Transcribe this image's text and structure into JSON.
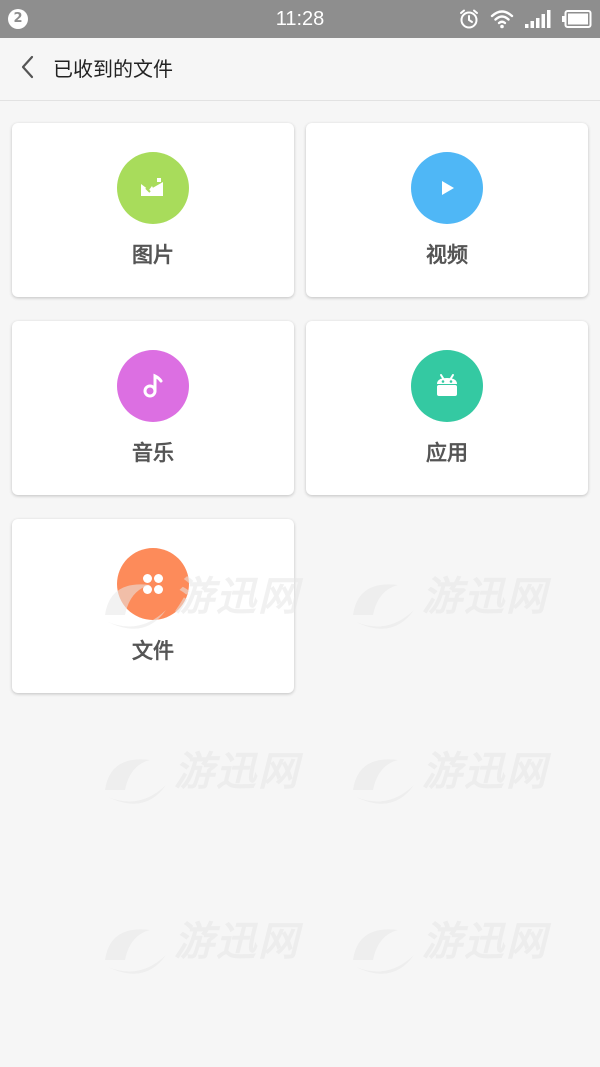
{
  "status_bar": {
    "notification_count": "2",
    "time": "11:28",
    "icons": [
      "alarm-icon",
      "wifi-icon",
      "signal-icon",
      "battery-icon"
    ]
  },
  "header": {
    "title": "已收到的文件",
    "back_icon": "chevron-left-icon"
  },
  "categories": [
    {
      "label": "图片",
      "icon": "image-icon",
      "color": "#a8dc5b"
    },
    {
      "label": "视频",
      "icon": "play-icon",
      "color": "#4fb7f6"
    },
    {
      "label": "音乐",
      "icon": "music-note-icon",
      "color": "#dc6fe2"
    },
    {
      "label": "应用",
      "icon": "android-icon",
      "color": "#34c9a2"
    },
    {
      "label": "文件",
      "icon": "apps-grid-icon",
      "color": "#fd8b5a"
    }
  ],
  "watermark": {
    "text": "游迅网"
  }
}
